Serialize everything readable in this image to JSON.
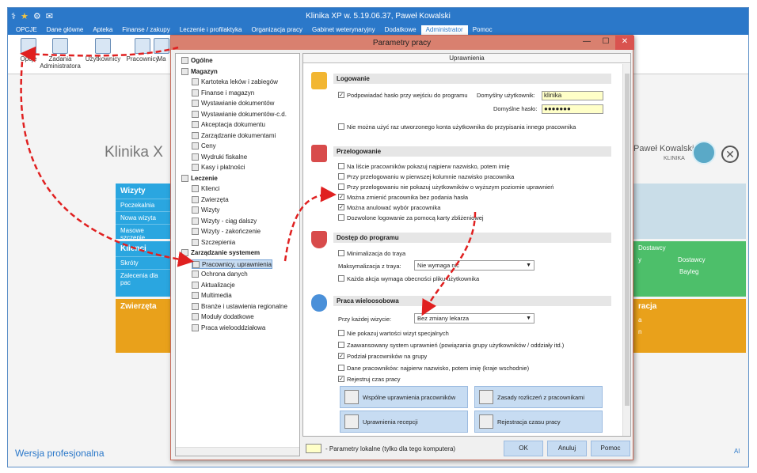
{
  "app": {
    "title": "Klinika XP w. 5.19.06.37, Paweł Kowalski",
    "tb_icons": [
      "app-icon",
      "star-icon",
      "gear-icon",
      "mail-icon"
    ],
    "accent": "#2b78c9"
  },
  "menu": [
    "OPCJE",
    "Dane główne",
    "Apteka",
    "Finanse / zakupy",
    "Leczenie i profilaktyka",
    "Organizacja pracy",
    "Gabinet weterynaryjny",
    "Dodatkowe",
    "Administrator",
    "Pomoc"
  ],
  "menu_active": "Administrator",
  "ribbon": {
    "opcje": "Opcje",
    "zadania": "Zadania Administratora",
    "uzytkownicy": "Użytkownicy",
    "pracownicy": "Pracownicy",
    "ma": "Ma"
  },
  "background": {
    "welcome": "Klinika X",
    "user_name": "Paweł Kowalski",
    "user_role": "KLINIKA",
    "close_glyph": "✕",
    "footer": "Wersja profesjonalna",
    "footer_right": "Al",
    "tiles": {
      "wizyty": {
        "title": "Wizyty",
        "links": [
          "Poczekalnia",
          "Nowa wizyta",
          "Masowe szczepie"
        ]
      },
      "klienci": {
        "title": "Klienci",
        "links": [
          "Skróty",
          "Zalecenia dla pac"
        ]
      },
      "zwierzeta": {
        "title": "Zwierzęta"
      },
      "right_green": {
        "links": [
          "Dostawcy",
          "y",
          "Dostawcy",
          "Bayleg"
        ]
      },
      "right_orange": {
        "title": "racja",
        "links": [
          "a",
          "n"
        ]
      }
    }
  },
  "dialog": {
    "title": "Parametry pracy",
    "minimize": "—",
    "maximize": "☐",
    "close": "✕",
    "panel_header": "Uprawnienia",
    "tree": [
      {
        "label": "Ogólne",
        "level": 0,
        "bold": true
      },
      {
        "label": "Magazyn",
        "level": 0,
        "bold": true
      },
      {
        "label": "Kartoteka leków i zabiegów",
        "level": 1
      },
      {
        "label": "Finanse i magazyn",
        "level": 1
      },
      {
        "label": "Wystawianie dokumentów",
        "level": 1
      },
      {
        "label": "Wystawianie dokumentów-c.d.",
        "level": 1
      },
      {
        "label": "Akceptacja dokumentu",
        "level": 1
      },
      {
        "label": "Zarządzanie dokumentami",
        "level": 1
      },
      {
        "label": "Ceny",
        "level": 1
      },
      {
        "label": "Wydruki fiskalne",
        "level": 1
      },
      {
        "label": "Kasy i płatności",
        "level": 1
      },
      {
        "label": "Leczenie",
        "level": 0,
        "bold": true
      },
      {
        "label": "Klienci",
        "level": 1
      },
      {
        "label": "Zwierzęta",
        "level": 1
      },
      {
        "label": "Wizyty",
        "level": 1
      },
      {
        "label": "Wizyty - ciąg dalszy",
        "level": 1
      },
      {
        "label": "Wizyty - zakończenie",
        "level": 1
      },
      {
        "label": "Szczepienia",
        "level": 1
      },
      {
        "label": "Zarządzanie systemem",
        "level": 0,
        "bold": true
      },
      {
        "label": "Pracownicy, uprawnienia",
        "level": 1,
        "selected": true
      },
      {
        "label": "Ochrona danych",
        "level": 1
      },
      {
        "label": "Aktualizacje",
        "level": 1
      },
      {
        "label": "Multimedia",
        "level": 1
      },
      {
        "label": "Branże i ustawienia regionalne",
        "level": 1
      },
      {
        "label": "Moduły dodatkowe",
        "level": 1
      },
      {
        "label": "Praca wielooddziałowa",
        "level": 1
      }
    ],
    "logowanie": {
      "title": "Logowanie",
      "cb1": "Podpowiadać hasło przy wejściu do programu",
      "cb1_checked": true,
      "user_label": "Domyślny użytkownik:",
      "user_value": "klinika",
      "pass_label": "Domyślne hasło:",
      "pass_value": "●●●●●●●",
      "cb2": "Nie można użyć raz utworzonego konta użytkownika do przypisania innego pracownika",
      "cb2_checked": false
    },
    "przelogowanie": {
      "title": "Przelogowanie",
      "items": [
        {
          "label": "Na liście pracowników pokazuj najpierw nazwisko, potem imię",
          "checked": false
        },
        {
          "label": "Przy przelogowaniu w pierwszej kolumnie nazwisko pracownika",
          "checked": false
        },
        {
          "label": "Przy przelogowaniu nie pokazuj użytkowników o wyższym poziomie uprawnień",
          "checked": false
        },
        {
          "label": "Można zmienić pracownika bez podania hasła",
          "checked": true
        },
        {
          "label": "Można anulować wybór pracownika",
          "checked": true
        },
        {
          "label": "Dozwolone logowanie za pomocą karty zbliżeniowej",
          "checked": false
        }
      ]
    },
    "dostep": {
      "title": "Dostęp do programu",
      "cb1": "Minimalizacja do traya",
      "cb1_checked": false,
      "max_label": "Maksymalizacja z traya:",
      "max_value": "Nie wymaga nic",
      "cb2": "Każda akcja wymaga obecności pliku użytkownika",
      "cb2_checked": false
    },
    "praca": {
      "title": "Praca wieloosobowa",
      "visit_label": "Przy każdej wizycie:",
      "visit_value": "Bez zmiany lekarza",
      "items": [
        {
          "label": "Nie pokazuj wartości wizyt specjalnych",
          "checked": false
        },
        {
          "label": "Zaawansowany system uprawnień (powiązania grupy użytkowników / oddziały itd.)",
          "checked": false
        },
        {
          "label": "Podział pracowników na grupy",
          "checked": true
        },
        {
          "label": "Dane pracowników: najpierw nazwisko, potem imię (kraje wschodnie)",
          "checked": false
        },
        {
          "label": "Rejestruj czas pracy",
          "checked": true
        }
      ],
      "btn1": "Wspólne uprawnienia pracowników",
      "btn2": "Zasady rozliczeń z pracownikami",
      "btn3": "Uprawnienia recepcji",
      "btn4": "Rejestracja czasu pracy"
    },
    "legend": "- Parametry lokalne (tylko dla tego komputera)",
    "ok": "OK",
    "cancel": "Anuluj",
    "help": "Pomoc"
  }
}
